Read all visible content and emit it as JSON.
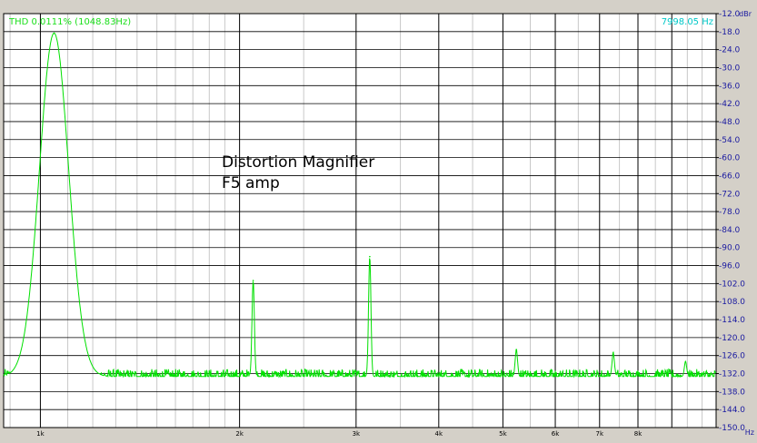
{
  "chart_data": {
    "type": "line",
    "title": "",
    "annotations": [
      "Distortion Magnifier",
      "F5 amp"
    ],
    "readout_left": "THD 0.0111% (1048.83Hz)",
    "readout_right": "7998.05 Hz",
    "ylabel_unit": "dBr",
    "xlabel_unit": "Hz",
    "xscale": "log",
    "xlim": [
      880,
      10500
    ],
    "ylim": [
      -150,
      -12
    ],
    "grid": true,
    "line_color": "#00e000",
    "x_ticks": [
      {
        "value": 1000,
        "label": "1k"
      },
      {
        "value": 2000,
        "label": "2k"
      },
      {
        "value": 3000,
        "label": "3k"
      },
      {
        "value": 4000,
        "label": "4k"
      },
      {
        "value": 5000,
        "label": "5k"
      },
      {
        "value": 6000,
        "label": "6k"
      },
      {
        "value": 7000,
        "label": "7k"
      },
      {
        "value": 8000,
        "label": "8k"
      }
    ],
    "x_major_grid": [
      1000,
      2000,
      3000,
      4000,
      5000,
      6000,
      7000,
      8000,
      9000
    ],
    "x_minor_grid": [
      900,
      1100,
      1200,
      1300,
      1400,
      1500,
      1600,
      1700,
      1800,
      1900,
      2500,
      3500,
      4500,
      5500,
      6500,
      7500,
      8500,
      9500,
      10000
    ],
    "y_ticks": [
      {
        "value": -12,
        "label": "-12.0"
      },
      {
        "value": -18,
        "label": "-18.0"
      },
      {
        "value": -24,
        "label": "-24.0"
      },
      {
        "value": -30,
        "label": "-30.0"
      },
      {
        "value": -36,
        "label": "-36.0"
      },
      {
        "value": -42,
        "label": "-42.0"
      },
      {
        "value": -48,
        "label": "-48.0"
      },
      {
        "value": -54,
        "label": "-54.0"
      },
      {
        "value": -60,
        "label": "-60.0"
      },
      {
        "value": -66,
        "label": "-66.0"
      },
      {
        "value": -72,
        "label": "-72.0"
      },
      {
        "value": -78,
        "label": "-78.0"
      },
      {
        "value": -84,
        "label": "-84.0"
      },
      {
        "value": -90,
        "label": "-90.0"
      },
      {
        "value": -96,
        "label": "-96.0"
      },
      {
        "value": -102,
        "label": "-102.0"
      },
      {
        "value": -108,
        "label": "-108.0"
      },
      {
        "value": -114,
        "label": "-114.0"
      },
      {
        "value": -120,
        "label": "-120.0"
      },
      {
        "value": -126,
        "label": "-126.0"
      },
      {
        "value": -132,
        "label": "-132.0"
      },
      {
        "value": -138,
        "label": "-138.0"
      },
      {
        "value": -144,
        "label": "-144.0"
      },
      {
        "value": -150,
        "label": "-150.0"
      }
    ],
    "noise_floor": -133,
    "noise_jitter": 2.5,
    "series": [
      {
        "peaks": [
          {
            "x": 1048.83,
            "y": -18.5
          },
          {
            "x": 2097,
            "y": -101
          },
          {
            "x": 3146,
            "y": -93
          },
          {
            "x": 5240,
            "y": -124
          },
          {
            "x": 7340,
            "y": -125
          },
          {
            "x": 9440,
            "y": -128
          }
        ]
      }
    ]
  }
}
